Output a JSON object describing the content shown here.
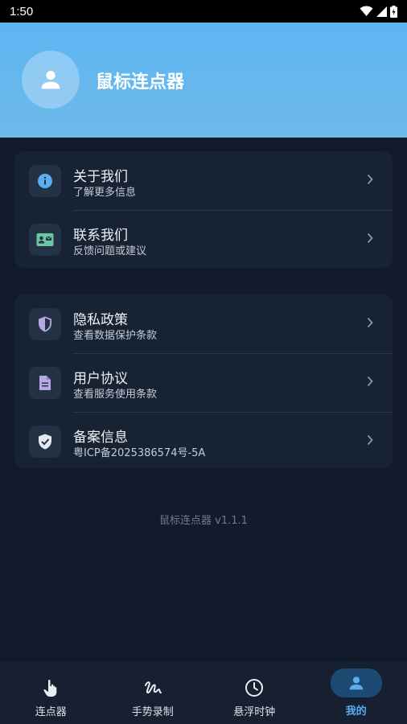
{
  "status_bar": {
    "time": "1:50"
  },
  "header": {
    "app_name": "鼠标连点器"
  },
  "group1": [
    {
      "title": "关于我们",
      "subtitle": "了解更多信息",
      "icon": "info-icon"
    },
    {
      "title": "联系我们",
      "subtitle": "反馈问题或建议",
      "icon": "contact-card-icon"
    }
  ],
  "group2": [
    {
      "title": "隐私政策",
      "subtitle": "查看数据保护条款",
      "icon": "shield-icon"
    },
    {
      "title": "用户协议",
      "subtitle": "查看服务使用条款",
      "icon": "document-icon"
    },
    {
      "title": "备案信息",
      "subtitle": "粤ICP备2025386574号-5A",
      "icon": "verified-shield-icon"
    }
  ],
  "version_text": "鼠标连点器 v1.1.1",
  "bottom_nav": [
    {
      "label": "连点器",
      "icon": "tap-icon"
    },
    {
      "label": "手势录制",
      "icon": "gesture-icon"
    },
    {
      "label": "悬浮时钟",
      "icon": "clock-icon"
    },
    {
      "label": "我的",
      "icon": "person-icon",
      "active": true
    }
  ],
  "colors": {
    "accent": "#58aef0",
    "header": "#5db5f2",
    "background": "#111b2b",
    "card": "#172232"
  }
}
